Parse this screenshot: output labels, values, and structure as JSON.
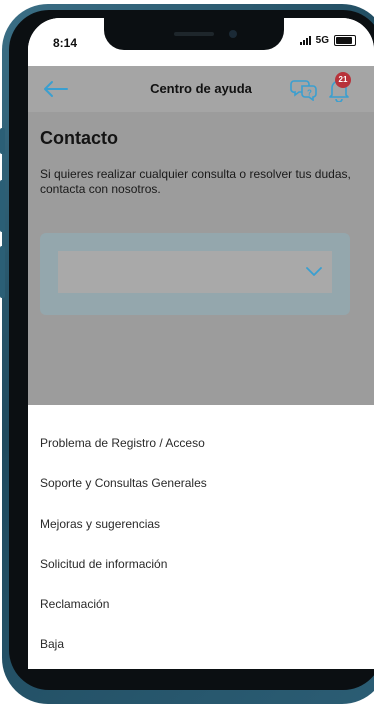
{
  "status": {
    "time": "8:14",
    "network": "5G"
  },
  "appbar": {
    "title": "Centro de ayuda",
    "badge": "21"
  },
  "main": {
    "heading": "Contacto",
    "description": "Si quieres realizar cualquier consulta o resolver tus dudas, contacta con nosotros.",
    "select_value": ""
  },
  "sheet": {
    "options": [
      "Problema de Registro / Acceso",
      "Soporte y Consultas Generales",
      "Mejoras y sugerencias",
      "Solicitud de información",
      "Reclamación",
      "Baja"
    ]
  },
  "colors": {
    "accent": "#3a9fd0",
    "badge": "#b8323a",
    "overlay": "#9c9c9c"
  },
  "icons": [
    "back-arrow-icon",
    "chat-help-icon",
    "bell-icon",
    "chevron-down-icon"
  ]
}
